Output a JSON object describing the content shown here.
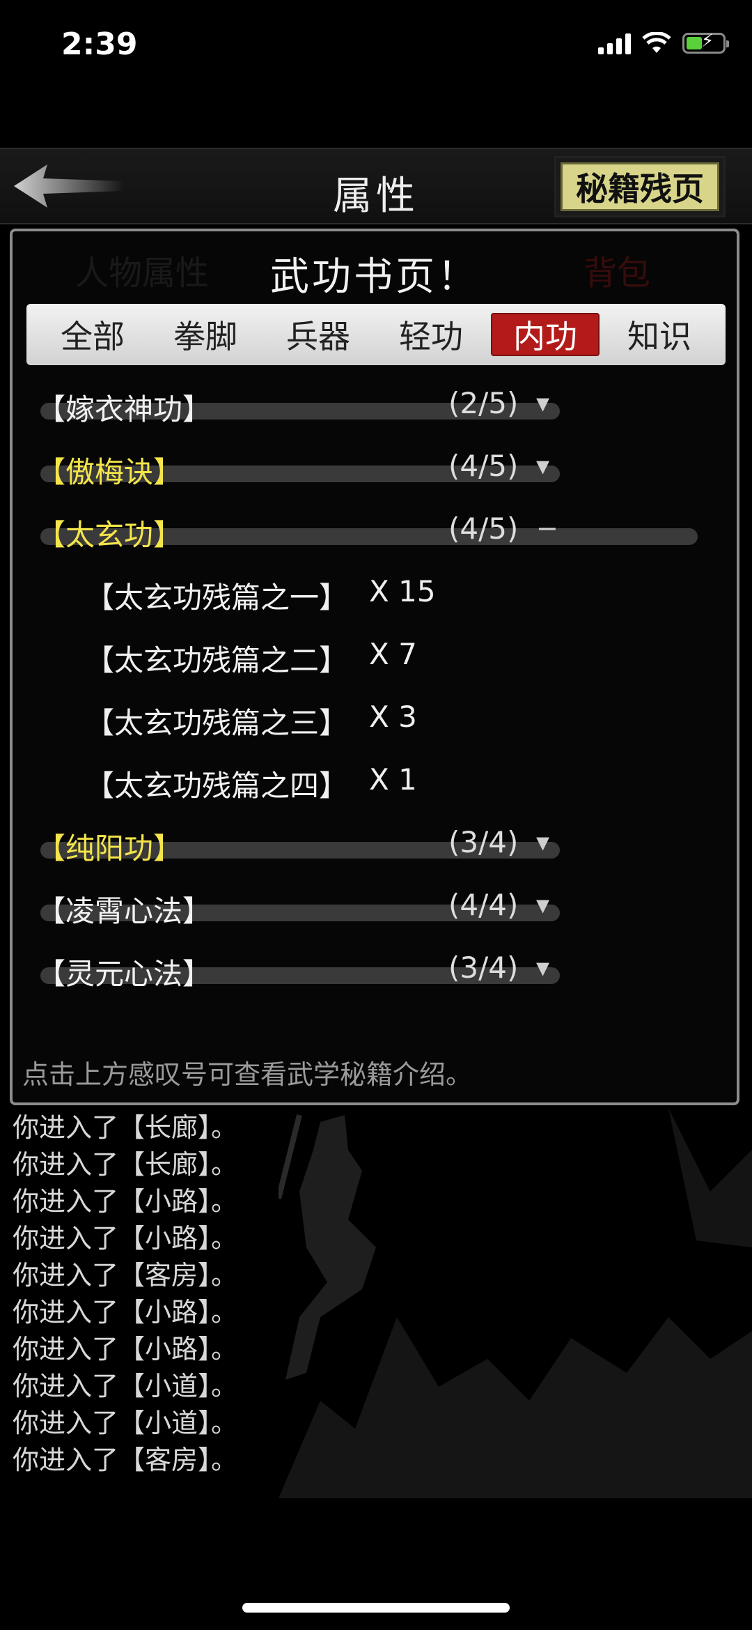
{
  "status": {
    "time": "2:39"
  },
  "header": {
    "title": "属性",
    "fragment_button": "秘籍残页"
  },
  "panel": {
    "title": "武功书页！",
    "background_ghost": {
      "tab_a": "人物属性",
      "tab_b": "背包"
    },
    "tabs": [
      {
        "label": "全部",
        "active": false
      },
      {
        "label": "拳脚",
        "active": false
      },
      {
        "label": "兵器",
        "active": false
      },
      {
        "label": "轻功",
        "active": false
      },
      {
        "label": "内功",
        "active": true
      },
      {
        "label": "知识",
        "active": false
      }
    ],
    "entries": [
      {
        "name": "【嫁衣神功】",
        "count": "(2/5)",
        "color": "white",
        "expanded": false
      },
      {
        "name": "【傲梅诀】",
        "count": "(4/5)",
        "color": "gold",
        "expanded": false
      },
      {
        "name": "【太玄功】",
        "count": "(4/5)",
        "color": "gold",
        "expanded": true,
        "children": [
          {
            "name": "【太玄功残篇之一】",
            "qty": "X 15"
          },
          {
            "name": "【太玄功残篇之二】",
            "qty": "X 7"
          },
          {
            "name": "【太玄功残篇之三】",
            "qty": "X 3"
          },
          {
            "name": "【太玄功残篇之四】",
            "qty": "X 1"
          }
        ]
      },
      {
        "name": "【纯阳功】",
        "count": "(3/4)",
        "color": "gold",
        "expanded": false
      },
      {
        "name": "【凌霄心法】",
        "count": "(4/4)",
        "color": "white",
        "expanded": false
      },
      {
        "name": "【灵元心法】",
        "count": "(3/4)",
        "color": "white",
        "expanded": false
      }
    ],
    "hint": "点击上方感叹号可查看武学秘籍介绍。"
  },
  "log": [
    "你进入了【长廊】。",
    "你进入了【长廊】。",
    "你进入了【小路】。",
    "你进入了【小路】。",
    "你进入了【客房】。",
    "你进入了【小路】。",
    "你进入了【小路】。",
    "你进入了【小道】。",
    "你进入了【小道】。",
    "你进入了【客房】。"
  ],
  "icons": {
    "expand": "chevron-down-icon",
    "collapse": "minus-icon"
  },
  "colors": {
    "gold_text": "#f4e54a",
    "active_tab": "#b31b1b",
    "fragment_button": "#d8d58a"
  }
}
